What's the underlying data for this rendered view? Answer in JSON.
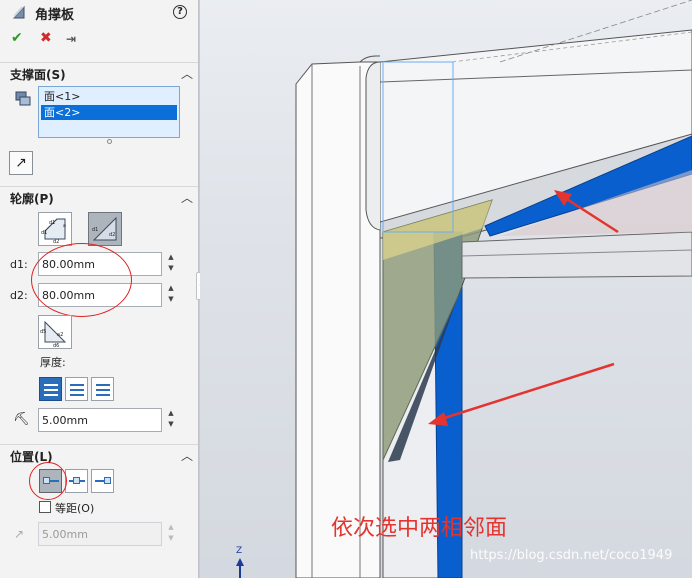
{
  "panel": {
    "title": "角撑板",
    "help": "?",
    "actions": {
      "ok": "✔",
      "cancel": "✖",
      "pin": "⇥"
    },
    "support_faces": {
      "title": "支撑面(S)",
      "items": [
        {
          "label": "面<1>",
          "selected": false
        },
        {
          "label": "面<2>",
          "selected": true
        }
      ]
    },
    "profile": {
      "title": "轮廓(P)",
      "d1": {
        "label": "d1:",
        "value": "80.00mm"
      },
      "d2": {
        "label": "d2:",
        "value": "80.00mm"
      },
      "thickness_label": "厚度:",
      "thickness_value": "5.00mm"
    },
    "position": {
      "title": "位置(L)",
      "equal_offset_label": "等距(O)",
      "equal_offset_checked": false,
      "offset_value": "5.00mm"
    }
  },
  "viewport": {
    "annotation": "依次选中两相邻面",
    "watermark": "https://blog.csdn.net/coco1949",
    "triad_axis": "Z"
  },
  "colors": {
    "selected_face": "#0a5fcf",
    "annotation_red": "#e4342f",
    "gusset_preview": "#8c9a78"
  }
}
